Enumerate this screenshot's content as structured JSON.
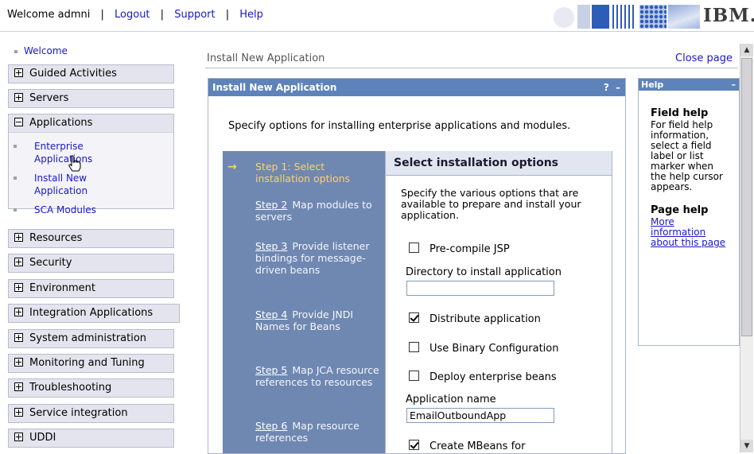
{
  "topbar": {
    "welcome": "Welcome admni",
    "logout": "Logout",
    "support": "Support",
    "help": "Help",
    "separator": "|",
    "brand": "IBM."
  },
  "nav": {
    "welcome": "Welcome",
    "categories": {
      "guided": "Guided Activities",
      "servers": "Servers",
      "applications": "Applications",
      "resources": "Resources",
      "security": "Security",
      "environment": "Environment",
      "integration": "Integration Applications",
      "sysadmin": "System administration",
      "monitoring": "Monitoring and Tuning",
      "troubleshooting": "Troubleshooting",
      "service": "Service integration",
      "uddi": "UDDI"
    },
    "app_items": {
      "enterprise_1": "Enterprise",
      "enterprise_2": "Applications",
      "install_1": "Install New",
      "install_2": "Application",
      "sca": "SCA Modules"
    }
  },
  "main": {
    "title": "Install New Application",
    "close_page": "Close page"
  },
  "panel": {
    "header": "Install New Application",
    "ctrl_help": "?",
    "ctrl_min": "–",
    "intro": "Specify options for installing enterprise applications and modules.",
    "steps": {
      "s1": "Step 1: Select installation options",
      "s2_link": "Step 2",
      "s2_text": "Map modules to servers",
      "s3_link": "Step 3",
      "s3_text": "Provide listener bindings for message-driven beans",
      "s4_link": "Step 4",
      "s4_text": "Provide JNDI Names for Beans",
      "s5_link": "Step 5",
      "s5_text": "Map JCA resource references to resources",
      "s6_link": "Step 6",
      "s6_text": "Map resource references"
    },
    "options": {
      "title": "Select installation options",
      "desc": "Specify the various options that are available to prepare and install your application.",
      "precompile": "Pre-compile JSP",
      "directory_label": "Directory to install application",
      "directory_value": "",
      "distribute": "Distribute application",
      "binary": "Use Binary Configuration",
      "deploy": "Deploy enterprise beans",
      "appname_label": "Application name",
      "appname_value": "EmailOutboundApp",
      "mbeans": "Create MBeans for"
    },
    "checkbox_states": {
      "precompile": false,
      "distribute": true,
      "binary": false,
      "deploy": false,
      "mbeans": true
    }
  },
  "help": {
    "header": "Help",
    "min": "–",
    "field_title": "Field help",
    "field_text": "For field help information, select a field label or list marker when the help cursor appears.",
    "page_title": "Page help",
    "page_link": "More information about this page"
  },
  "colors": {
    "header_blue": "#5d83ba",
    "steps_blue": "#6f88b2",
    "link_blue": "#1a17c9",
    "current_step": "#ffd35a"
  }
}
